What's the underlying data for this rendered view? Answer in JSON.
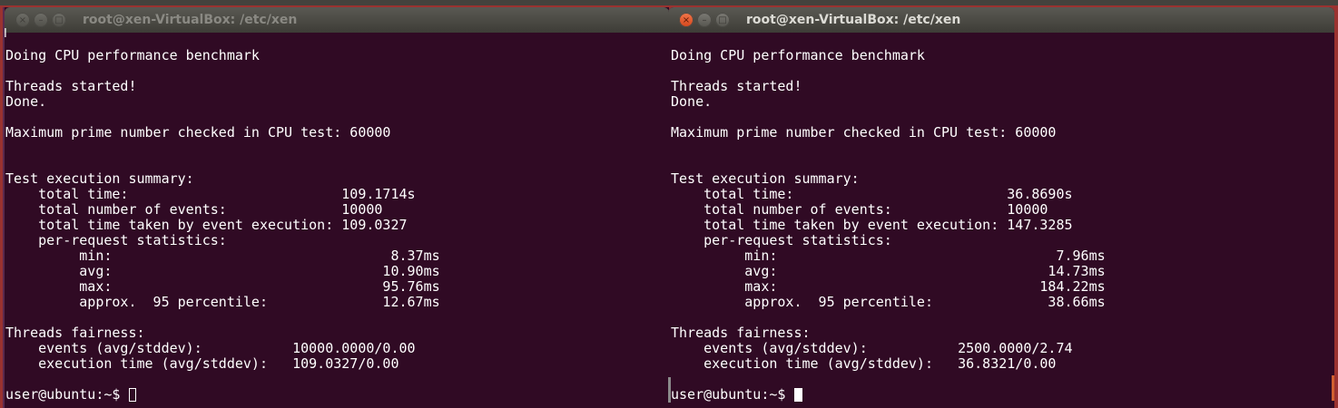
{
  "windows": [
    {
      "title": "root@xen-VirtualBox: /etc/xen",
      "active": false,
      "lines": [
        "",
        "Doing CPU performance benchmark",
        "",
        "Threads started!",
        "Done.",
        "",
        "Maximum prime number checked in CPU test: 60000",
        "",
        "",
        "Test execution summary:",
        "    total time:                          109.1714s",
        "    total number of events:              10000",
        "    total time taken by event execution: 109.0327",
        "    per-request statistics:",
        "         min:                                  8.37ms",
        "         avg:                                 10.90ms",
        "         max:                                 95.76ms",
        "         approx.  95 percentile:              12.67ms",
        "",
        "Threads fairness:",
        "    events (avg/stddev):           10000.0000/0.00",
        "    execution time (avg/stddev):   109.0327/0.00",
        ""
      ],
      "prompt": "user@ubuntu:~$ "
    },
    {
      "title": "root@xen-VirtualBox: /etc/xen",
      "active": true,
      "lines": [
        "",
        "Doing CPU performance benchmark",
        "",
        "Threads started!",
        "Done.",
        "",
        "Maximum prime number checked in CPU test: 60000",
        "",
        "",
        "Test execution summary:",
        "    total time:                          36.8690s",
        "    total number of events:              10000",
        "    total time taken by event execution: 147.3285",
        "    per-request statistics:",
        "         min:                                  7.96ms",
        "         avg:                                 14.73ms",
        "         max:                                184.22ms",
        "         approx.  95 percentile:              38.66ms",
        "",
        "Threads fairness:",
        "    events (avg/stddev):           2500.0000/2.74",
        "    execution time (avg/stddev):   36.8321/0.00",
        ""
      ],
      "prompt": "user@ubuntu:~$ "
    }
  ],
  "icons": {
    "close": "×",
    "minimize": "–",
    "maximize": "□"
  },
  "colors": {
    "terminal_bg": "#300a24",
    "terminal_fg": "#ffffff",
    "close_active": "#e9562a"
  }
}
